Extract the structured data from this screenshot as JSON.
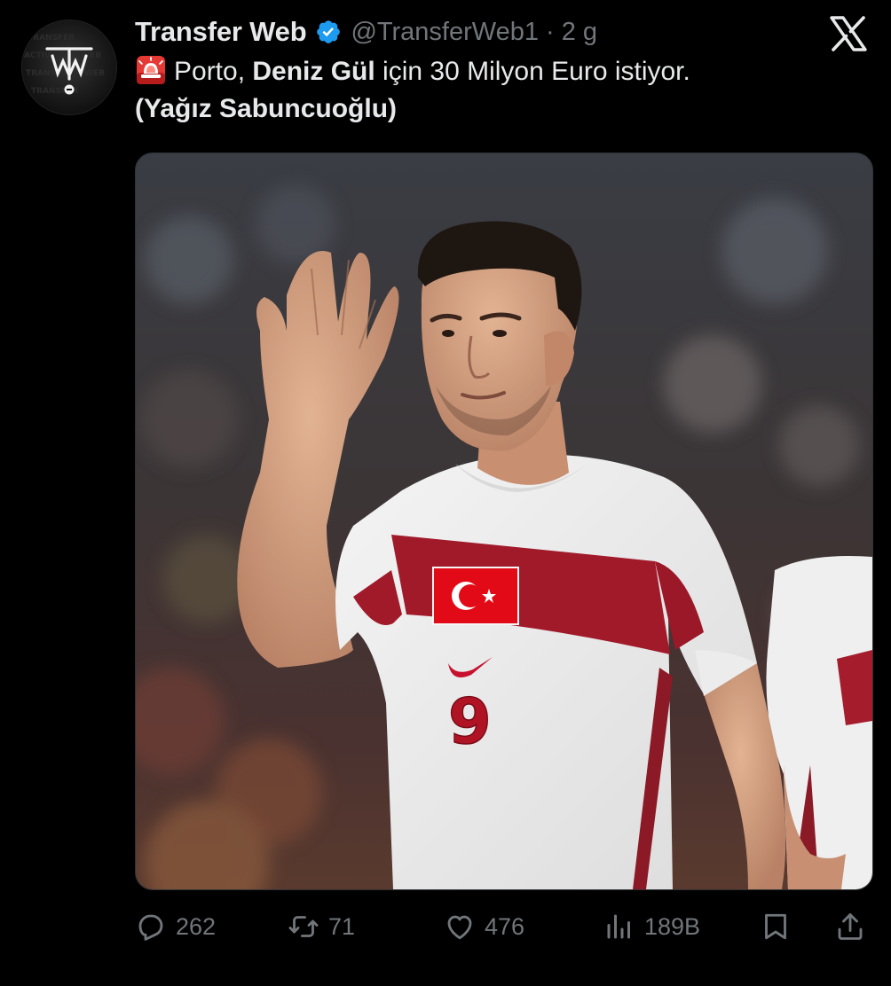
{
  "tweet": {
    "display_name": "Transfer Web",
    "handle": "@TransferWeb1",
    "separator": "·",
    "time": "2 g",
    "text": {
      "line1_pre": "Porto, ",
      "line1_bold": "Deniz Gül",
      "line1_post": " için 30 Milyon Euro istiyor.",
      "line2": "(Yağız Sabuncuoğlu)"
    },
    "siren_icon": "rotating-light-emoji",
    "avatar_logo_letters": "TW",
    "media": {
      "jersey_number": "9"
    }
  },
  "actions": {
    "reply_count": "262",
    "retweet_count": "71",
    "like_count": "476",
    "views_count": "189B"
  },
  "icons": {
    "verified": "verified-badge-icon",
    "platform": "x-logo-icon",
    "reply": "reply-icon",
    "retweet": "retweet-icon",
    "like": "heart-icon",
    "views": "views-icon",
    "bookmark": "bookmark-icon",
    "share": "share-icon"
  },
  "colors": {
    "background": "#000000",
    "text_primary": "#e7e9ea",
    "text_secondary": "#71767b",
    "verified_blue": "#1d9bf0",
    "jersey_red": "#c8102e"
  }
}
